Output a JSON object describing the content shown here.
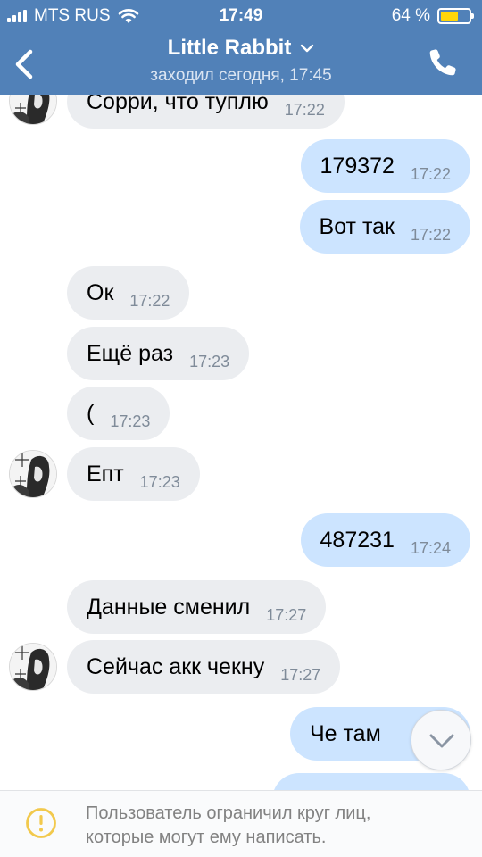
{
  "status_bar": {
    "carrier": "MTS RUS",
    "time": "17:49",
    "battery_percent": "64 %",
    "battery_level": 0.64
  },
  "header": {
    "contact_name": "Little Rabbit",
    "last_seen": "заходил сегодня, 17:45",
    "icons": [
      "back-arrow-icon",
      "chevron-down-icon",
      "phone-icon"
    ]
  },
  "colors": {
    "header_bg": "#5181b8",
    "incoming_bubble": "#ebedf0",
    "outgoing_bubble": "#cce4ff",
    "time_text": "#7f8b99",
    "warning": "#f2c94c"
  },
  "messages": [
    {
      "direction": "in",
      "text": "Сорри, что туплю",
      "time": "17:22",
      "avatar": true
    },
    {
      "direction": "out",
      "text": "179372",
      "time": "17:22"
    },
    {
      "direction": "out",
      "text": "Вот так",
      "time": "17:22"
    },
    {
      "direction": "in",
      "text": "Ок",
      "time": "17:22"
    },
    {
      "direction": "in",
      "text": "Ещё раз",
      "time": "17:23"
    },
    {
      "direction": "in",
      "text": "(",
      "time": "17:23"
    },
    {
      "direction": "in",
      "text": "Епт",
      "time": "17:23",
      "avatar": true
    },
    {
      "direction": "out",
      "text": "487231",
      "time": "17:24"
    },
    {
      "direction": "in",
      "text": "Данные сменил",
      "time": "17:27"
    },
    {
      "direction": "in",
      "text": "Сейчас акк чекну",
      "time": "17:27",
      "avatar": true
    },
    {
      "direction": "out",
      "text": "Че там",
      "time": ""
    },
    {
      "direction": "out",
      "text": "",
      "time": ""
    }
  ],
  "scroll_down_icon": "chevron-down-icon",
  "footer": {
    "icon": "warning-icon",
    "text_line1": "Пользователь ограничил круг лиц,",
    "text_line2": "которые могут ему написать."
  }
}
